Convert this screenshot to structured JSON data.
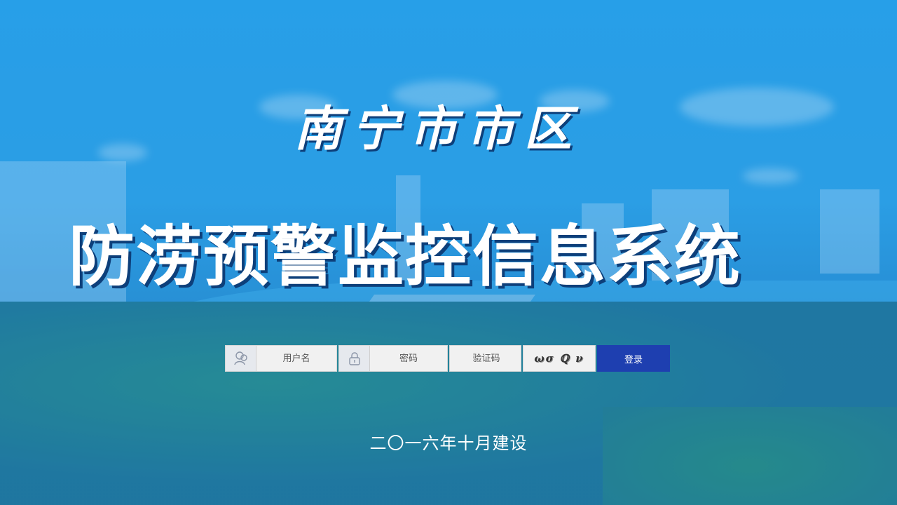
{
  "header": {
    "title_line1": "南宁市市区",
    "title_line2": "防涝预警监控信息系统"
  },
  "login": {
    "username_placeholder": "用户名",
    "username_icon": "user-icon",
    "password_placeholder": "密码",
    "password_icon": "lock-icon",
    "captcha_placeholder": "验证码",
    "captcha_text": "ωσ ℚ ν",
    "submit_label": "登录",
    "submit_color": "#1e3fb0"
  },
  "footer": {
    "text": "二〇一六年十月建设"
  }
}
